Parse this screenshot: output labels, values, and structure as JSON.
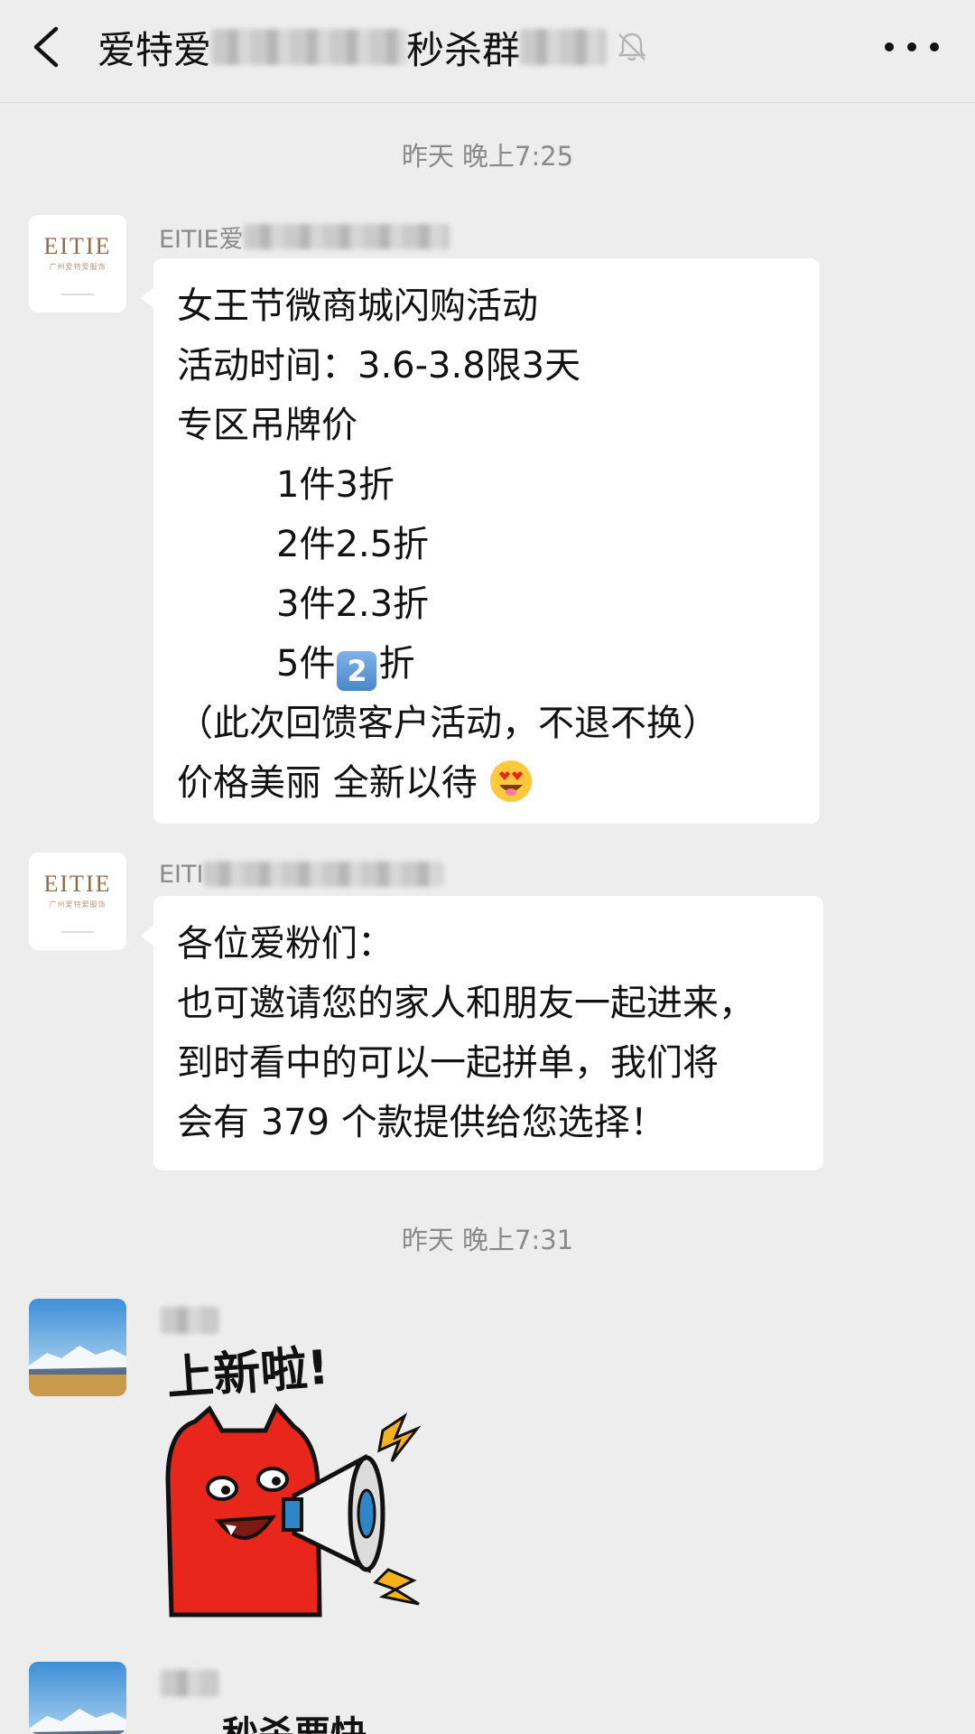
{
  "header": {
    "title_start": "爱特爱",
    "title_middle": "秒杀群",
    "title_end": ""
  },
  "timestamps": [
    "昨天 晚上7:25",
    "昨天 晚上7:31"
  ],
  "messages": [
    {
      "sender": "EITIE爱",
      "avatar_text": "EITIE",
      "avatar_subtext": "广州爱特爱服饰",
      "lines": [
        "女王节微商城闪购活动",
        "活动时间：3.6-3.8限3天",
        "专区吊牌价",
        "1件3折",
        "2件2.5折",
        "3件2.3折",
        "5件",
        "2",
        "折",
        "（此次回馈客户活动，不退不换）",
        "价格美丽 全新以待"
      ]
    },
    {
      "sender": "EITI",
      "avatar_text": "EITIE",
      "avatar_subtext": "广州爱特爱服饰",
      "lines": [
        "各位爱粉们：",
        "也可邀请您的家人和朋友一起进来，",
        "到时看中的可以一起拼单，我们将",
        "会有 379 个款提供给您选择！"
      ]
    },
    {
      "sticker_text": "上新啦!"
    },
    {
      "sticker_text": "秒杀要快"
    }
  ],
  "colors": {
    "background": "#ededed",
    "bubble": "#ffffff",
    "timestamp": "#8a8a8a",
    "sticker_red": "#e8261c",
    "sticker_yellow": "#f5b21b"
  }
}
